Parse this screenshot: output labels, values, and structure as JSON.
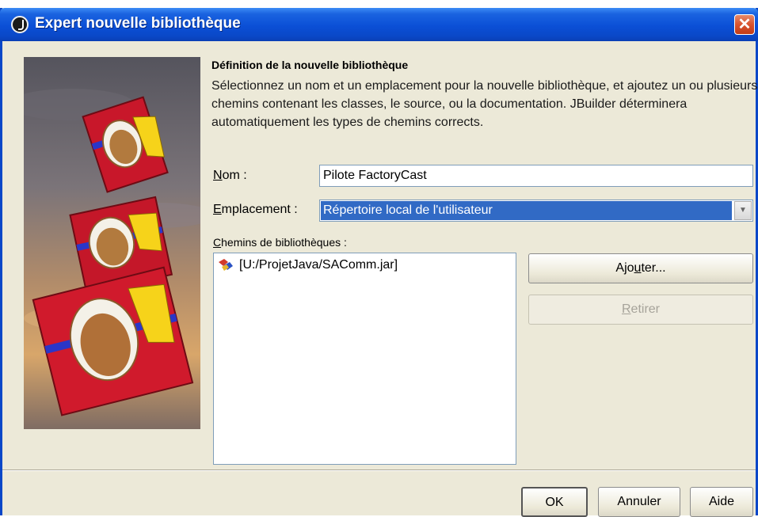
{
  "window": {
    "title": "Expert nouvelle bibliothèque",
    "close_label": "✕"
  },
  "main": {
    "heading": "Définition de la nouvelle bibliothèque",
    "description": "Sélectionnez un nom et un emplacement pour la nouvelle bibliothèque, et ajoutez un ou plusieurs chemins contenant les classes, le source, ou la documentation. JBuilder déterminera automatiquement les types de chemins corrects."
  },
  "form": {
    "nom_label_u": "N",
    "nom_label_rest": "om :",
    "nom_value": "Pilote FactoryCast",
    "emplacement_label_u": "E",
    "emplacement_label_rest": "mplacement :",
    "emplacement_value": "Répertoire local de l'utilisateur",
    "chemins_label_u": "C",
    "chemins_label_rest": "hemins de bibliothèques :"
  },
  "paths": {
    "items": [
      {
        "label": "[U:/ProjetJava/SAComm.jar]",
        "icon": "jar-icon"
      }
    ]
  },
  "buttons": {
    "ajouter_a": "Ajo",
    "ajouter_u": "u",
    "ajouter_rest": "ter...",
    "retirer_u": "R",
    "retirer_rest": "etirer",
    "ok": "OK",
    "annuler": "Annuler",
    "aide": "Aide"
  }
}
